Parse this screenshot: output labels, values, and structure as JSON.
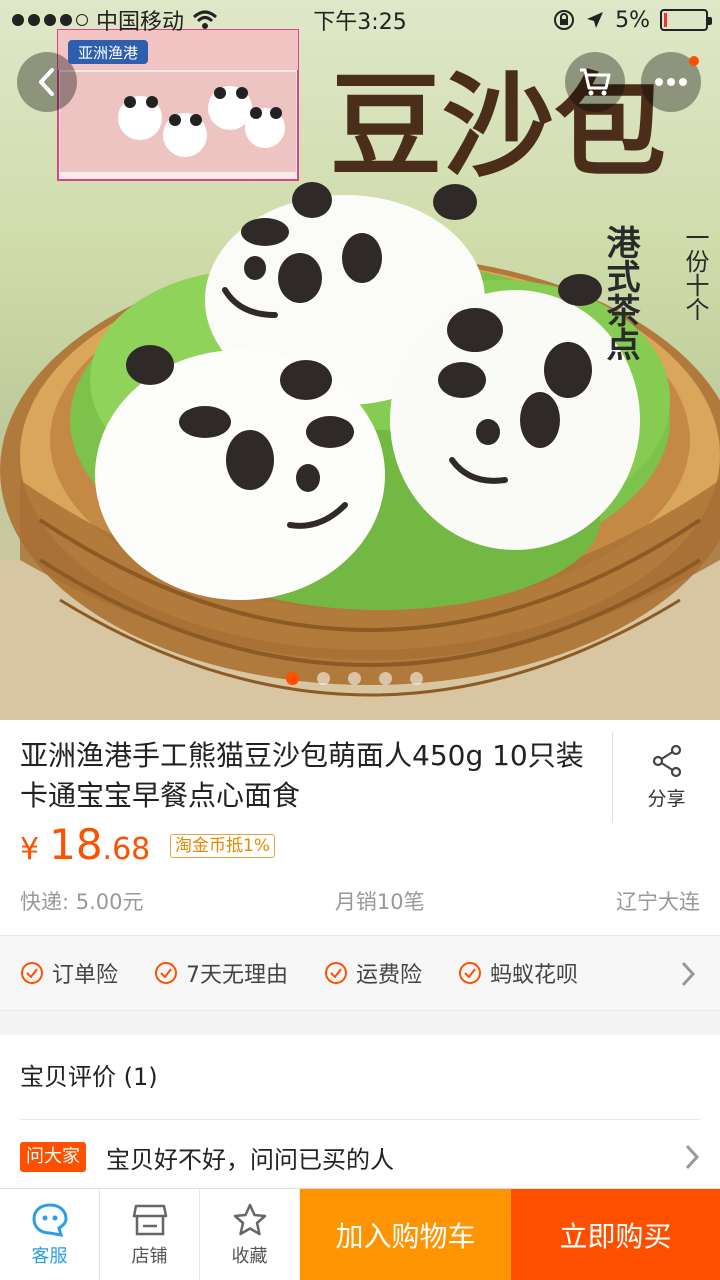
{
  "status_bar": {
    "carrier": "中国移动",
    "time": "下午3:25",
    "battery": "5%"
  },
  "hero": {
    "box_brand": "亚洲渔港",
    "headline": "豆沙包",
    "sub_vertical_1": "港式茶点",
    "sub_vertical_2": "一份十个",
    "pager_total": 5,
    "pager_active": 1
  },
  "product": {
    "title": "亚洲渔港手工熊猫豆沙包萌面人450g 10只装卡通宝宝早餐点心面食",
    "share_label": "分享",
    "price_currency": "¥",
    "price_int": "18",
    "price_dec": ".68",
    "coin_badge": "淘金币抵1%",
    "shipping": "快递: 5.00元",
    "monthly_sales": "月销10笔",
    "location": "辽宁大连"
  },
  "guarantees": [
    "订单险",
    "7天无理由",
    "运费险",
    "蚂蚁花呗"
  ],
  "reviews": {
    "title": "宝贝评价 (1)",
    "ask_badge": "问大家",
    "ask_text": "宝贝好不好，问问已买的人"
  },
  "bottom_bar": {
    "service": "客服",
    "shop": "店铺",
    "favorite": "收藏",
    "add_cart": "加入购物车",
    "buy_now": "立即购买"
  },
  "colors": {
    "accent": "#ff5000",
    "cart_button": "#ff9402",
    "service_blue": "#2a9ee8"
  }
}
